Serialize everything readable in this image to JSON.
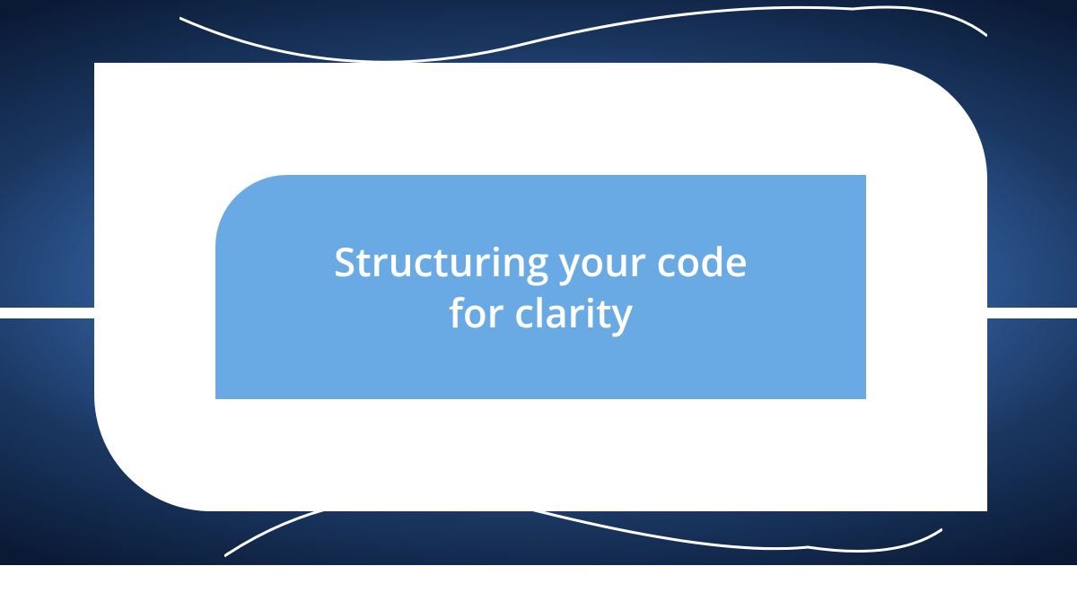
{
  "title": "Structuring your code\nfor clarity",
  "colors": {
    "inner_bg": "#69a9e4",
    "text": "#ffffff"
  }
}
